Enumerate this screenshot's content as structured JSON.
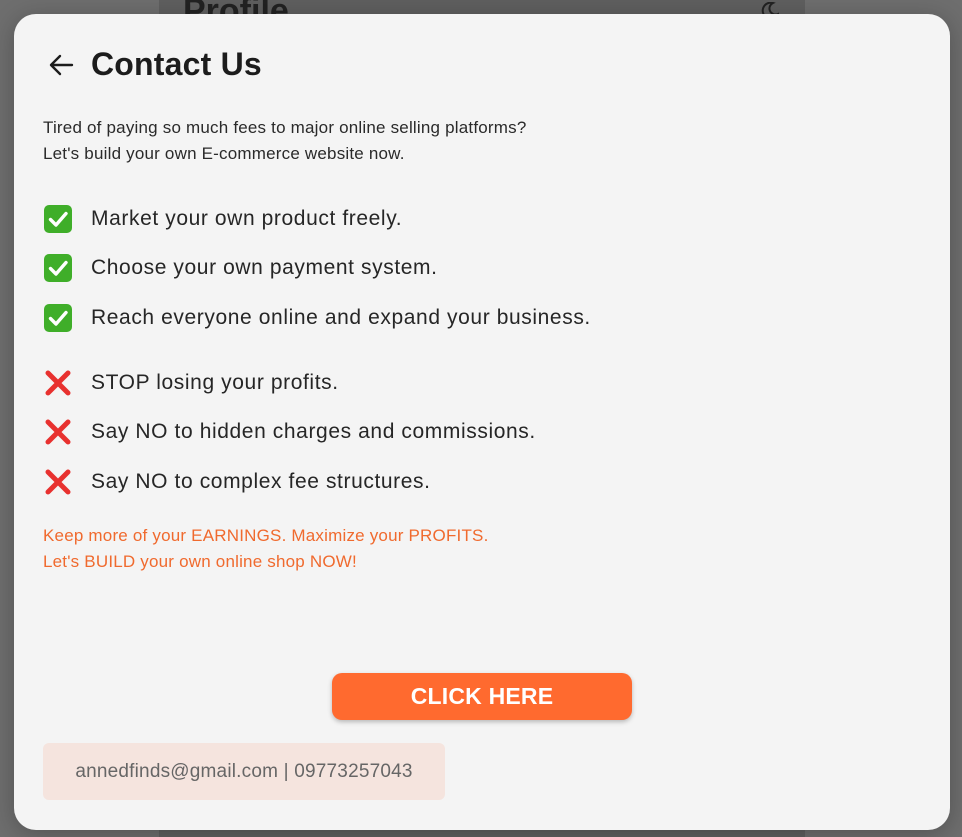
{
  "background": {
    "page_title": "Profile",
    "theme_icon": "moon-icon"
  },
  "modal": {
    "title": "Contact Us",
    "back_icon": "arrow-left-icon",
    "intro_lines": [
      "Tired of paying so much fees to major online selling platforms?",
      "Let's build your own E-commerce website now."
    ],
    "pros": [
      {
        "icon": "check-mark-icon",
        "text": "Market your own product freely."
      },
      {
        "icon": "check-mark-icon",
        "text": "Choose your own payment system."
      },
      {
        "icon": "check-mark-icon",
        "text": "Reach everyone online and expand your business."
      }
    ],
    "cons": [
      {
        "icon": "cross-mark-icon",
        "text": "STOP losing your profits."
      },
      {
        "icon": "cross-mark-icon",
        "text": "Say NO to hidden charges and commissions."
      },
      {
        "icon": "cross-mark-icon",
        "text": "Say NO to complex fee structures."
      }
    ],
    "promo_lines": [
      "Keep more of your EARNINGS. Maximize your PROFITS.",
      "Let's BUILD your own online shop NOW!"
    ],
    "cta_label": "CLICK HERE",
    "contact": "annedfinds@gmail.com | 09773257043"
  },
  "colors": {
    "accent": "#ff6a2f",
    "promo_text": "#f06a2e",
    "check_green": "#3fae29",
    "cross_red": "#e8312f",
    "contact_bg": "#f5e4de"
  }
}
